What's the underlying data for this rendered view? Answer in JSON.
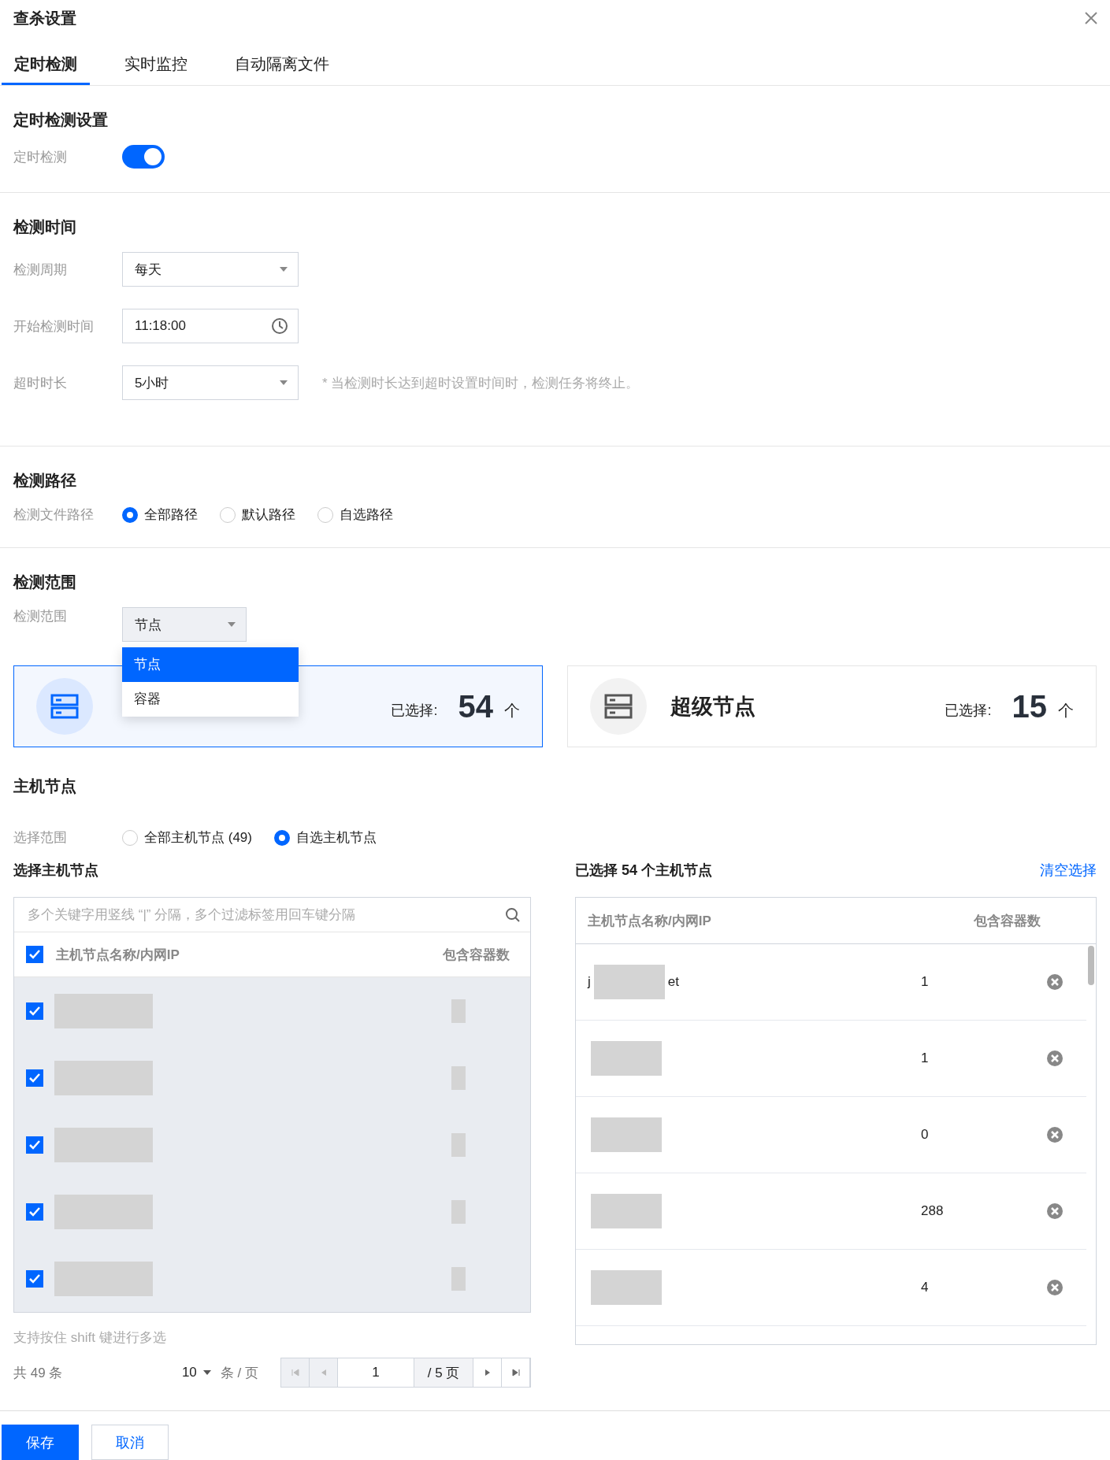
{
  "dialog": {
    "title": "查杀设置"
  },
  "tabs": [
    {
      "label": "定时检测",
      "selected": true
    },
    {
      "label": "实时监控",
      "selected": false
    },
    {
      "label": "自动隔离文件",
      "selected": false
    }
  ],
  "schedule_section": {
    "title": "定时检测设置",
    "toggle_label": "定时检测",
    "toggle_on": true
  },
  "time_section": {
    "title": "检测时间",
    "fields": [
      {
        "kind": "select",
        "label": "检测周期",
        "value": "每天"
      },
      {
        "kind": "time",
        "label": "开始检测时间",
        "value": "11:18:00"
      },
      {
        "kind": "select",
        "label": "超时时长",
        "value": "5小时",
        "hint": "* 当检测时长达到超时设置时间时，检测任务将终止。"
      }
    ]
  },
  "path_section": {
    "title": "检测路径",
    "label": "检测文件路径",
    "options": [
      {
        "label": "全部路径",
        "selected": true
      },
      {
        "label": "默认路径",
        "selected": false
      },
      {
        "label": "自选路径",
        "selected": false
      }
    ]
  },
  "scope_section": {
    "title": "检测范围",
    "label": "检测范围",
    "value": "节点",
    "dropdown_open": true,
    "options": [
      {
        "label": "节点",
        "selected": true
      },
      {
        "label": "容器",
        "selected": false
      }
    ],
    "cards": [
      {
        "selected": true,
        "count_label": "已选择:",
        "count": "54",
        "unit": "个"
      },
      {
        "title": "超级节点",
        "selected": false,
        "count_label": "已选择:",
        "count": "15",
        "unit": "个"
      }
    ]
  },
  "host_section": {
    "title": "主机节点",
    "range_label": "选择范围",
    "range_options": [
      {
        "label": "全部主机节点 (49)",
        "selected": false
      },
      {
        "label": "自选主机节点",
        "selected": true
      }
    ]
  },
  "left_panel": {
    "title": "选择主机节点",
    "search_placeholder": "多个关键字用竖线 “|” 分隔，多个过滤标签用回车键分隔",
    "all_checked": true,
    "columns": [
      "主机节点名称/内网IP",
      "包含容器数"
    ],
    "rows": [
      {
        "checked": true
      },
      {
        "checked": true
      },
      {
        "checked": true
      },
      {
        "checked": true
      },
      {
        "checked": true
      }
    ],
    "hint": "支持按住 shift 键进行多选",
    "pagination": {
      "total": "共 49 条",
      "page_size": "10",
      "page_size_unit": "条 / 页",
      "page": "1",
      "page_count": "/ 5 页"
    }
  },
  "right_panel": {
    "title": "已选择 54 个主机节点",
    "clear_link": "清空选择",
    "columns": [
      "主机节点名称/内网IP",
      "包含容器数"
    ],
    "rows": [
      {
        "name_start": "j",
        "name_end": "et",
        "containers": "1"
      },
      {
        "containers": "1"
      },
      {
        "containers": "0"
      },
      {
        "containers": "288"
      },
      {
        "containers": "4"
      }
    ]
  },
  "footer": {
    "buttons": [
      {
        "label": "保存",
        "kind": "primary"
      },
      {
        "label": "取消",
        "kind": "secondary"
      }
    ]
  }
}
